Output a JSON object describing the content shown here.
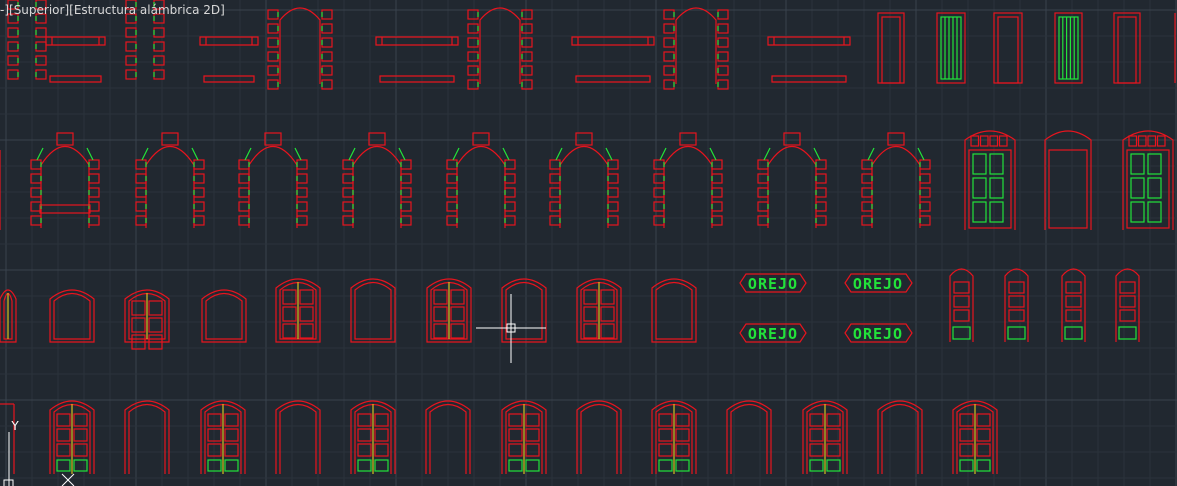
{
  "viewport": {
    "label": "-][Superior][Estructura alámbrica 2D]",
    "background": "#212830",
    "grid_minor_color": "#2b323b",
    "grid_major_color": "#39424d"
  },
  "colors": {
    "outline": "#e8141e",
    "accent": "#22e33a",
    "mullion": "#d8c020",
    "crosshair": "#ffffff",
    "ucs": "#ffffff"
  },
  "labels": {
    "orejo": "OREJO"
  },
  "ucs": {
    "y_label": "Y",
    "icon": "ucs-icon"
  },
  "cursor": {
    "icon": "crosshair-cursor-icon"
  }
}
